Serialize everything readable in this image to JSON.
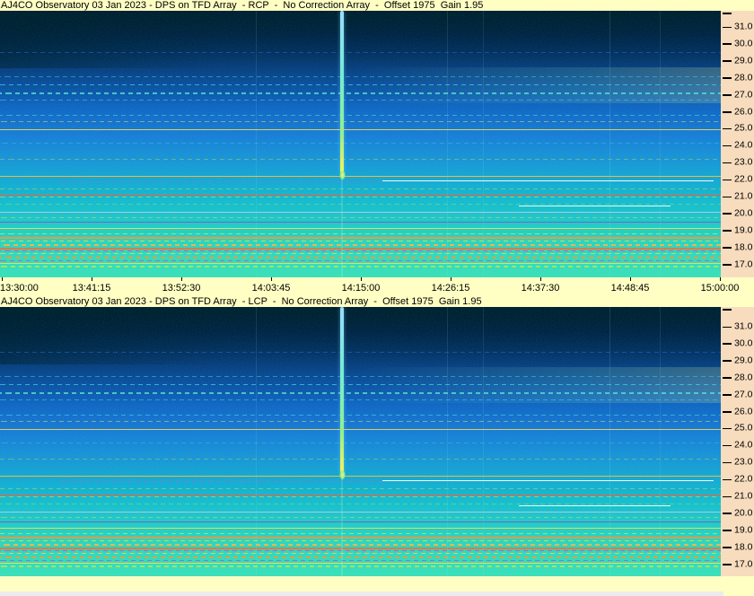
{
  "panels": [
    {
      "title": "AJ4CO Observatory 03 Jan 2023 - DPS on TFD Array  - RCP  -  No Correction Array  -  Offset 1975  Gain 1.95"
    },
    {
      "title": "AJ4CO Observatory 03 Jan 2023 - DPS on TFD Array  - LCP  -  No Correction Array  -  Offset 1975  Gain 1.95"
    }
  ],
  "freq_axis": {
    "ticks": [
      "31.0",
      "30.0",
      "29.0",
      "28.0",
      "27.0",
      "26.0",
      "25.0",
      "24.0",
      "23.0",
      "22.0",
      "21.0",
      "20.0",
      "19.0",
      "18.0",
      "17.0"
    ]
  },
  "time_axis": {
    "ticks": [
      "13:30:00",
      "13:41:15",
      "13:52:30",
      "14:03:45",
      "14:15:00",
      "14:26:15",
      "14:37:30",
      "14:48:45",
      "15:00:00"
    ]
  },
  "colors": {
    "bar_bg": "#ffffc4",
    "axis_bg": "#f8dcbe",
    "strip": "#ebebee",
    "text": "#000000"
  },
  "chart_data": {
    "type": "heatmap",
    "subtype": "radio-spectrogram-dynamic-spectrum",
    "panels": [
      "RCP",
      "LCP"
    ],
    "title_rcp": "AJ4CO Observatory 03 Jan 2023 - DPS on TFD Array - RCP - No Correction Array - Offset 1975 Gain 1.95",
    "title_lcp": "AJ4CO Observatory 03 Jan 2023 - DPS on TFD Array - LCP - No Correction Array - Offset 1975 Gain 1.95",
    "x_ticks": [
      "13:30:00",
      "13:41:15",
      "13:52:30",
      "14:03:45",
      "14:15:00",
      "14:26:15",
      "14:37:30",
      "14:48:45",
      "15:00:00"
    ],
    "x_range": [
      "13:30:00",
      "15:00:00"
    ],
    "y_ticks": [
      31.0,
      30.0,
      29.0,
      28.0,
      27.0,
      26.0,
      25.0,
      24.0,
      23.0,
      22.0,
      21.0,
      20.0,
      19.0,
      18.0,
      17.0
    ],
    "y_range_mhz": [
      16.6,
      31.6
    ],
    "colormap": "intensity: black -> dark blue -> blue -> cyan -> green -> yellow -> orange -> red -> white",
    "background": "low intensity (black/dark blue) at high frequencies grading to brighter cyan-green at low frequencies",
    "vertical_streak": {
      "time_approx": "14:13",
      "from_mhz": 31.6,
      "to_mhz": 22.4,
      "note": "bright narrow vertical event visible in both RCP and LCP panels"
    },
    "speckle_band_mhz": [
      26.5,
      28.5
    ],
    "rfi_lines_mhz": [
      27.3,
      25.6,
      24.95,
      22.2,
      21.95,
      21.1,
      20.45,
      20.1,
      19.5,
      19.15,
      18.6,
      18.2,
      18.0,
      17.8,
      17.45,
      17.1,
      16.95
    ]
  },
  "render": {
    "streak": {
      "x_frac": 0.4745,
      "f_end": 22.4,
      "colors": [
        "#9adcff",
        "#74ecd2",
        "#93f08e",
        "#eef25e"
      ]
    },
    "band": {
      "f_top": 28.6,
      "f_bot": 26.5
    },
    "verticals": [
      {
        "x": 0.355,
        "o": 0.12
      },
      {
        "x": 0.62,
        "o": 0.12
      },
      {
        "x": 0.67,
        "o": 0.1
      },
      {
        "x": 0.845,
        "o": 0.14
      },
      {
        "x": 0.915,
        "o": 0.1
      }
    ],
    "lines": [
      {
        "f": 29.5,
        "c": "#2a6adf",
        "s": "speck",
        "o": 0.5
      },
      {
        "f": 28.1,
        "c": "#35c8e8",
        "s": "speck",
        "o": 0.55
      },
      {
        "f": 27.6,
        "c": "#40d8e8",
        "s": "speck",
        "o": 0.7
      },
      {
        "f": 27.15,
        "c": "#52e0d0",
        "s": "speck",
        "o": 0.8,
        "h": 2
      },
      {
        "f": 26.7,
        "c": "#3fc8e0",
        "s": "speck",
        "o": 0.6
      },
      {
        "f": 25.8,
        "c": "#48d8d8",
        "s": "speck",
        "o": 0.6
      },
      {
        "f": 25.45,
        "c": "#ffe04a",
        "s": "speck",
        "o": 0.5
      },
      {
        "f": 24.95,
        "c": "#ffd34a",
        "s": "solid",
        "o": 0.9
      },
      {
        "f": 24.2,
        "c": "#46c8e8",
        "s": "speck",
        "o": 0.4
      },
      {
        "f": 23.2,
        "c": "#ffe04a",
        "s": "speck",
        "o": 0.35
      },
      {
        "f": 22.2,
        "c": "#ffb838",
        "s": "solid",
        "o": 0.95
      },
      {
        "f": 21.95,
        "c": "#ffffff",
        "s": "solid",
        "o": 0.95,
        "x0": 0.53,
        "x1": 0.99
      },
      {
        "f": 21.9,
        "c": "#c060d0",
        "s": "speck",
        "o": 0.5,
        "x0": 0.08,
        "x1": 0.53
      },
      {
        "f": 21.5,
        "c": "#ffe04a",
        "s": "speck",
        "o": 0.4
      },
      {
        "f": 21.1,
        "c": "#ff5a30",
        "s": "solid",
        "o": 0.95
      },
      {
        "f": 21.0,
        "c": "#ffd040",
        "s": "speck",
        "o": 0.6
      },
      {
        "f": 20.6,
        "c": "#8fe860",
        "s": "speck",
        "o": 0.5
      },
      {
        "f": 20.45,
        "c": "#ffffff",
        "s": "solid",
        "o": 0.9,
        "x0": 0.72,
        "x1": 0.93
      },
      {
        "f": 20.1,
        "c": "#cfc0ff",
        "s": "solid",
        "o": 0.85
      },
      {
        "f": 19.8,
        "c": "#ffd040",
        "s": "speck",
        "o": 0.5
      },
      {
        "f": 19.5,
        "c": "#9050c8",
        "s": "solid",
        "o": 0.9
      },
      {
        "f": 19.15,
        "c": "#ffe04a",
        "s": "solid",
        "o": 0.85
      },
      {
        "f": 18.85,
        "c": "#b8f070",
        "s": "speck",
        "o": 0.7
      },
      {
        "f": 18.6,
        "c": "#ff9430",
        "s": "solid",
        "o": 0.9,
        "h": 2
      },
      {
        "f": 18.4,
        "c": "#d8e850",
        "s": "speck",
        "o": 0.8
      },
      {
        "f": 18.2,
        "c": "#ffb838",
        "s": "speck",
        "o": 0.85,
        "h": 2
      },
      {
        "f": 18.0,
        "c": "#ff6a3a",
        "s": "solid",
        "o": 0.9,
        "h": 2
      },
      {
        "f": 17.8,
        "c": "#c050c0",
        "s": "speck",
        "o": 0.8
      },
      {
        "f": 17.65,
        "c": "#ffd040",
        "s": "speck",
        "o": 0.8
      },
      {
        "f": 17.45,
        "c": "#ff9430",
        "s": "speck",
        "o": 0.85,
        "h": 2
      },
      {
        "f": 17.25,
        "c": "#b050c8",
        "s": "speck",
        "o": 0.7
      },
      {
        "f": 17.1,
        "c": "#ffe04a",
        "s": "solid",
        "o": 0.85
      },
      {
        "f": 16.95,
        "c": "#a8e858",
        "s": "speck",
        "o": 0.9,
        "h": 2
      }
    ]
  }
}
